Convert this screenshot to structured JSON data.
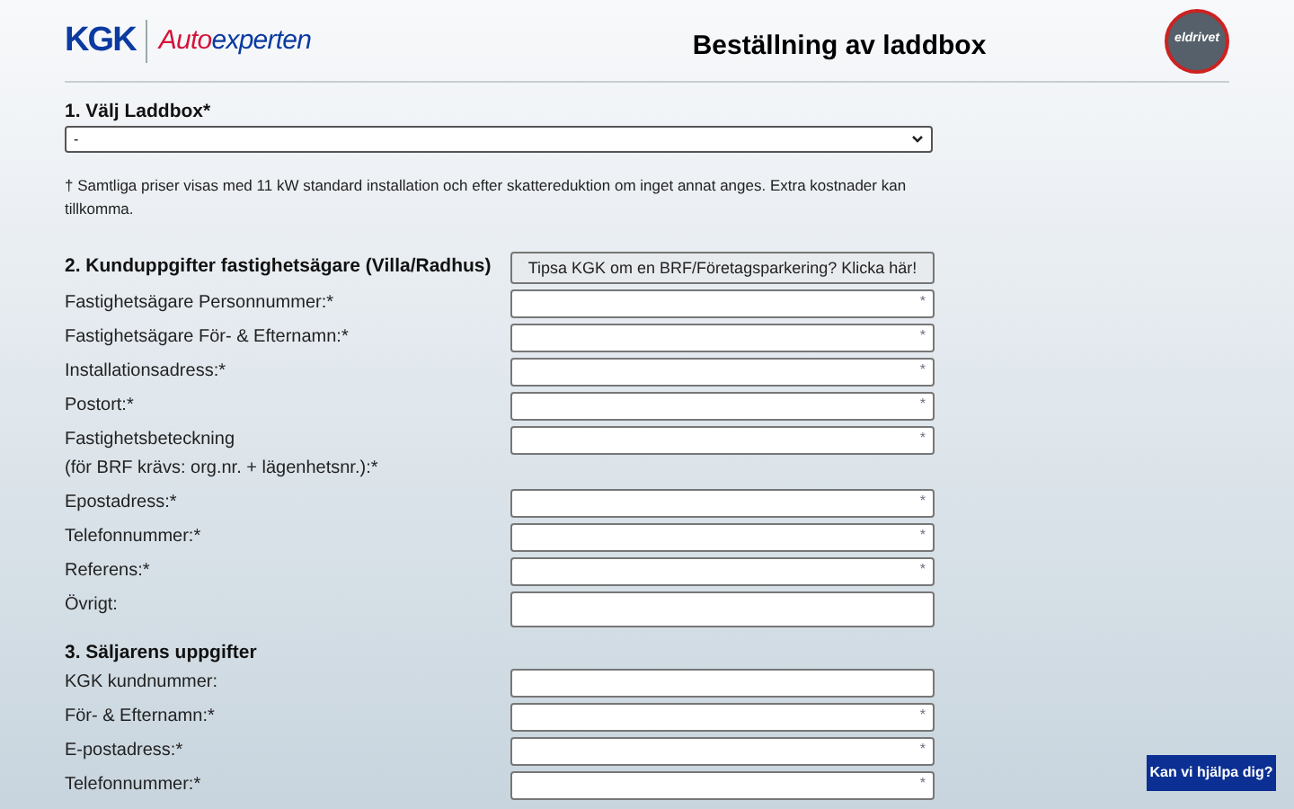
{
  "header": {
    "brand": "KGK",
    "partner_prefix": "Auto",
    "partner_suffix": "experten",
    "title": "Beställning av laddbox",
    "badge": "eldrivet"
  },
  "section_1": {
    "heading": "1. Välj Laddbox*",
    "select": {
      "value": "-"
    },
    "note": "† Samtliga priser visas med 11 kW standard installation och efter skattereduktion om inget annat anges. Extra kostnader kan tillkomma."
  },
  "section_2": {
    "heading": "2. Kunduppgifter fastighetsägare (Villa/Radhus)",
    "tip_button": "Tipsa KGK om en BRF/Företagsparkering? Klicka här!",
    "fields": [
      {
        "kind": "input",
        "label": "Fastighetsägare Personnummer:*",
        "marker": "*"
      },
      {
        "kind": "input",
        "label": "Fastighetsägare För- & Efternamn:*",
        "marker": "*"
      },
      {
        "kind": "input",
        "label": "Installationsadress:*",
        "marker": "*"
      },
      {
        "kind": "input",
        "label": "Postort:*",
        "marker": "*"
      },
      {
        "kind": "input",
        "label": "Fastighetsbeteckning",
        "sublabel": "(för BRF krävs: org.nr. + lägenhetsnr.):*",
        "marker": "*"
      },
      {
        "kind": "input",
        "label": "Epostadress:*",
        "marker": "*"
      },
      {
        "kind": "input",
        "label": "Telefonnummer:*",
        "marker": "*"
      },
      {
        "kind": "input",
        "label": "Referens:*",
        "marker": "*"
      },
      {
        "kind": "textarea",
        "label": "Övrigt:"
      }
    ]
  },
  "section_3": {
    "heading": "3. Säljarens uppgifter",
    "fields": [
      {
        "kind": "input",
        "label": "KGK kundnummer:"
      },
      {
        "kind": "input",
        "label": "För- & Efternamn:*",
        "marker": "*"
      },
      {
        "kind": "input",
        "label": "E-postadress:*",
        "marker": "*"
      },
      {
        "kind": "input",
        "label": "Telefonnummer:*",
        "marker": "*"
      }
    ]
  },
  "help_button": "Kan vi hjälpa dig?"
}
